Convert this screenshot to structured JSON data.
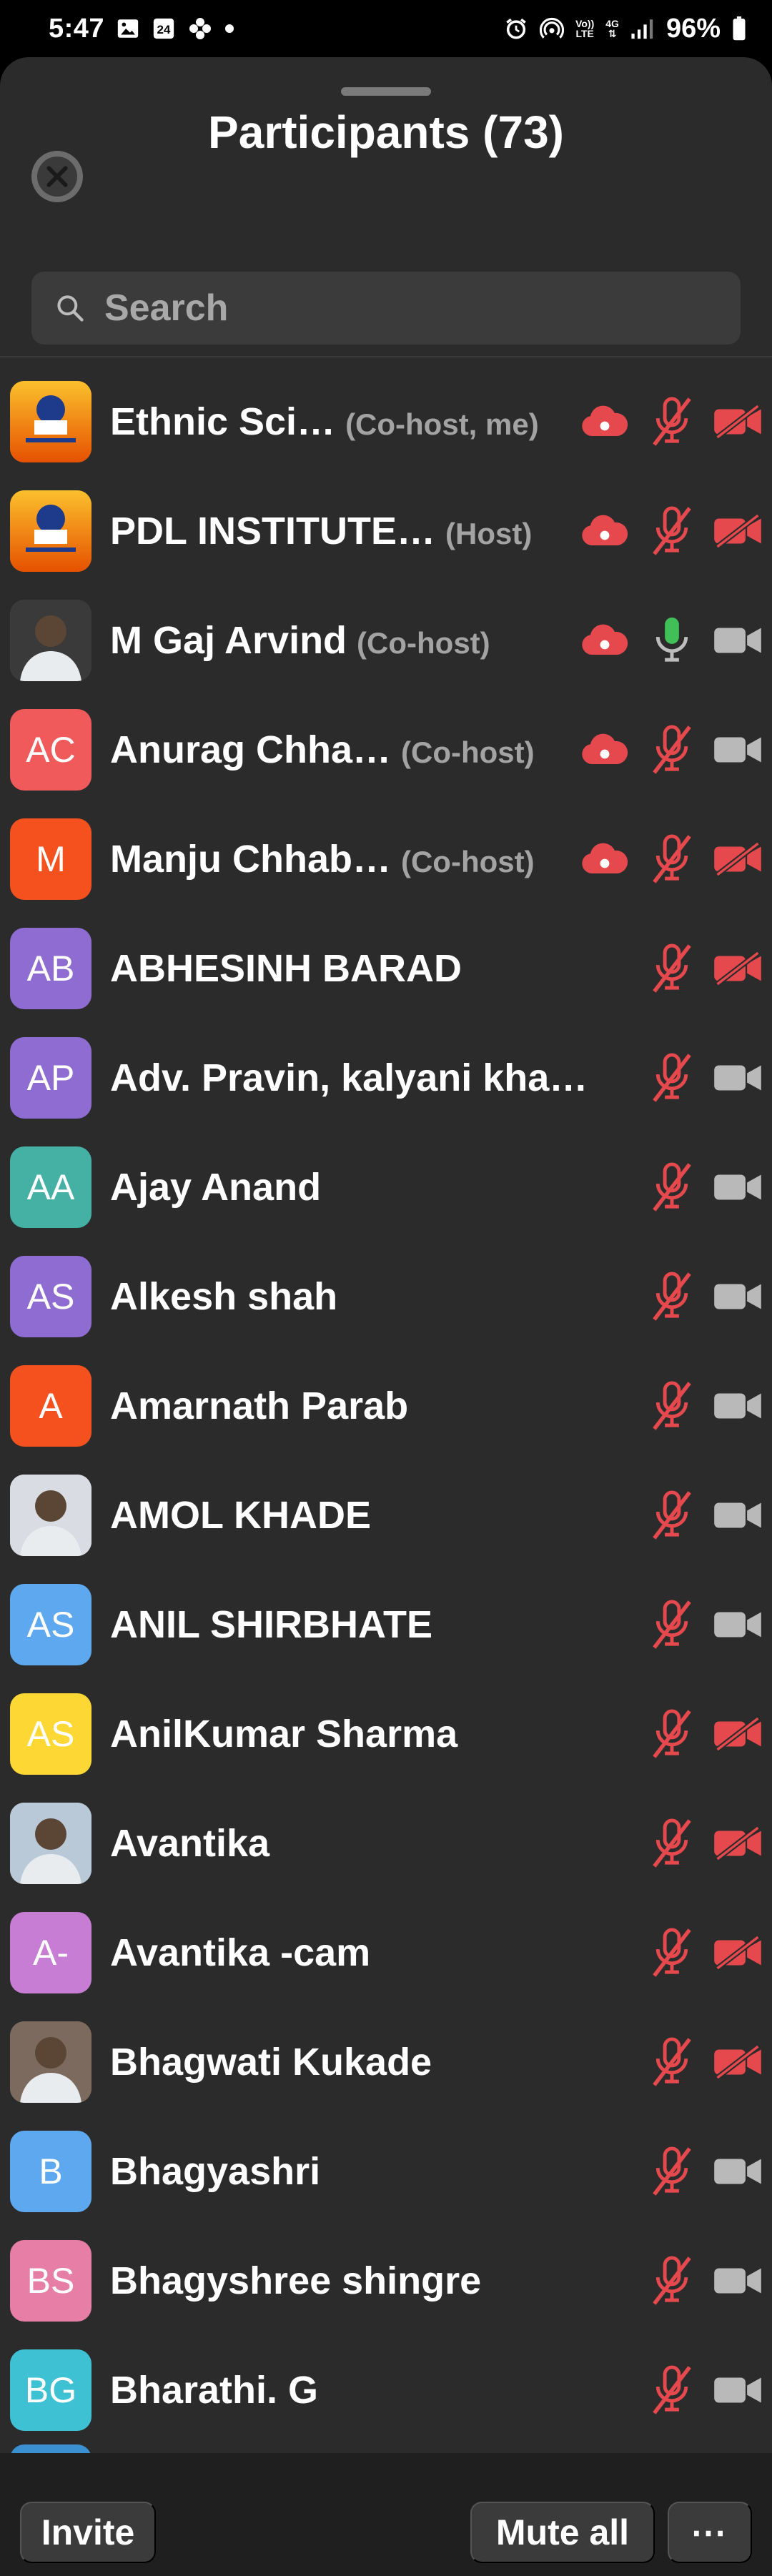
{
  "status_bar": {
    "time": "5:47",
    "notif_badge": "24",
    "network_top": "Vo))",
    "network_bottom": "LTE",
    "network_gen": "4G",
    "battery": "96%"
  },
  "sheet": {
    "title": "Participants (73)",
    "search_placeholder": "Search"
  },
  "colors": {
    "sheet_bg": "#2b2b2b",
    "muted_red": "#e5484d",
    "active_mic_green": "#40c057",
    "role_gray": "#a3a3a3"
  },
  "participants": [
    {
      "name": "Ethnic Sci…",
      "role": "(Co-host, me)",
      "initials": "",
      "avatar_color": "#e8890f",
      "avatar_type": "logo",
      "cloud": true,
      "mic": "muted",
      "cam": "off"
    },
    {
      "name": "PDL INSTITUTE…",
      "role": "(Host)",
      "initials": "",
      "avatar_color": "#e8890f",
      "avatar_type": "logo",
      "cloud": true,
      "mic": "muted",
      "cam": "off"
    },
    {
      "name": "M Gaj Arvind",
      "role": "(Co-host)",
      "initials": "",
      "avatar_color": "#3a3a3a",
      "avatar_type": "photo",
      "cloud": true,
      "mic": "active",
      "cam": "on"
    },
    {
      "name": "Anurag Chha…",
      "role": "(Co-host)",
      "initials": "AC",
      "avatar_color": "#f05a5a",
      "avatar_type": "initials",
      "cloud": true,
      "mic": "muted",
      "cam": "on"
    },
    {
      "name": "Manju Chhab…",
      "role": "(Co-host)",
      "initials": "M",
      "avatar_color": "#f4511e",
      "avatar_type": "initials",
      "cloud": true,
      "mic": "muted",
      "cam": "off"
    },
    {
      "name": "ABHESINH BARAD",
      "role": "",
      "initials": "AB",
      "avatar_color": "#8e6cd1",
      "avatar_type": "initials",
      "cloud": false,
      "mic": "muted",
      "cam": "off"
    },
    {
      "name": "Adv. Pravin, kalyani kha…",
      "role": "",
      "initials": "AP",
      "avatar_color": "#8e6cd1",
      "avatar_type": "initials",
      "cloud": false,
      "mic": "muted",
      "cam": "on"
    },
    {
      "name": "Ajay Anand",
      "role": "",
      "initials": "AA",
      "avatar_color": "#45b0a4",
      "avatar_type": "initials",
      "cloud": false,
      "mic": "muted",
      "cam": "on"
    },
    {
      "name": "Alkesh shah",
      "role": "",
      "initials": "AS",
      "avatar_color": "#8e6cd1",
      "avatar_type": "initials",
      "cloud": false,
      "mic": "muted",
      "cam": "on"
    },
    {
      "name": "Amarnath Parab",
      "role": "",
      "initials": "A",
      "avatar_color": "#f4511e",
      "avatar_type": "initials",
      "cloud": false,
      "mic": "muted",
      "cam": "on"
    },
    {
      "name": "AMOL KHADE",
      "role": "",
      "initials": "",
      "avatar_color": "#d9dde3",
      "avatar_type": "photo",
      "cloud": false,
      "mic": "muted",
      "cam": "on"
    },
    {
      "name": "ANIL SHIRBHATE",
      "role": "",
      "initials": "AS",
      "avatar_color": "#5ea8f0",
      "avatar_type": "initials",
      "cloud": false,
      "mic": "muted",
      "cam": "on"
    },
    {
      "name": "AnilKumar Sharma",
      "role": "",
      "initials": "AS",
      "avatar_color": "#fdd835",
      "avatar_type": "initials",
      "cloud": false,
      "mic": "muted",
      "cam": "off"
    },
    {
      "name": "Avantika",
      "role": "",
      "initials": "",
      "avatar_color": "#b9c9d8",
      "avatar_type": "photo",
      "cloud": false,
      "mic": "muted",
      "cam": "off"
    },
    {
      "name": "Avantika -cam",
      "role": "",
      "initials": "A-",
      "avatar_color": "#c77dd4",
      "avatar_type": "initials",
      "cloud": false,
      "mic": "muted",
      "cam": "off"
    },
    {
      "name": "Bhagwati Kukade",
      "role": "",
      "initials": "",
      "avatar_color": "#7d6a5e",
      "avatar_type": "photo",
      "cloud": false,
      "mic": "muted",
      "cam": "off"
    },
    {
      "name": "Bhagyashri",
      "role": "",
      "initials": "B",
      "avatar_color": "#5ea8f0",
      "avatar_type": "initials",
      "cloud": false,
      "mic": "muted",
      "cam": "on"
    },
    {
      "name": "Bhagyshree shingre",
      "role": "",
      "initials": "BS",
      "avatar_color": "#e67ea6",
      "avatar_type": "initials",
      "cloud": false,
      "mic": "muted",
      "cam": "on"
    },
    {
      "name": "Bharathi. G",
      "role": "",
      "initials": "BG",
      "avatar_color": "#3ec1d3",
      "avatar_type": "initials",
      "cloud": false,
      "mic": "muted",
      "cam": "on"
    }
  ],
  "bottom_bar": {
    "invite_label": "Invite",
    "mute_all_label": "Mute all",
    "more_label": "⋯"
  }
}
